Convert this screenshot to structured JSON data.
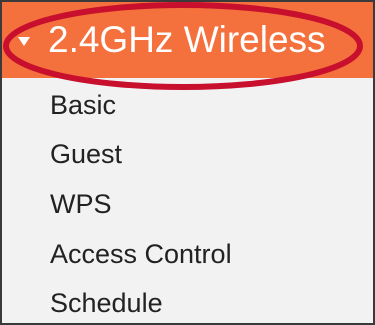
{
  "menu": {
    "section_title": "2.4GHz Wireless",
    "expand_icon": "triangle-down-icon",
    "accent_color": "#f4713d",
    "highlight_color": "#c8102e",
    "items": [
      {
        "label": "Basic"
      },
      {
        "label": "Guest"
      },
      {
        "label": "WPS"
      },
      {
        "label": "Access Control"
      },
      {
        "label": "Schedule"
      }
    ]
  }
}
